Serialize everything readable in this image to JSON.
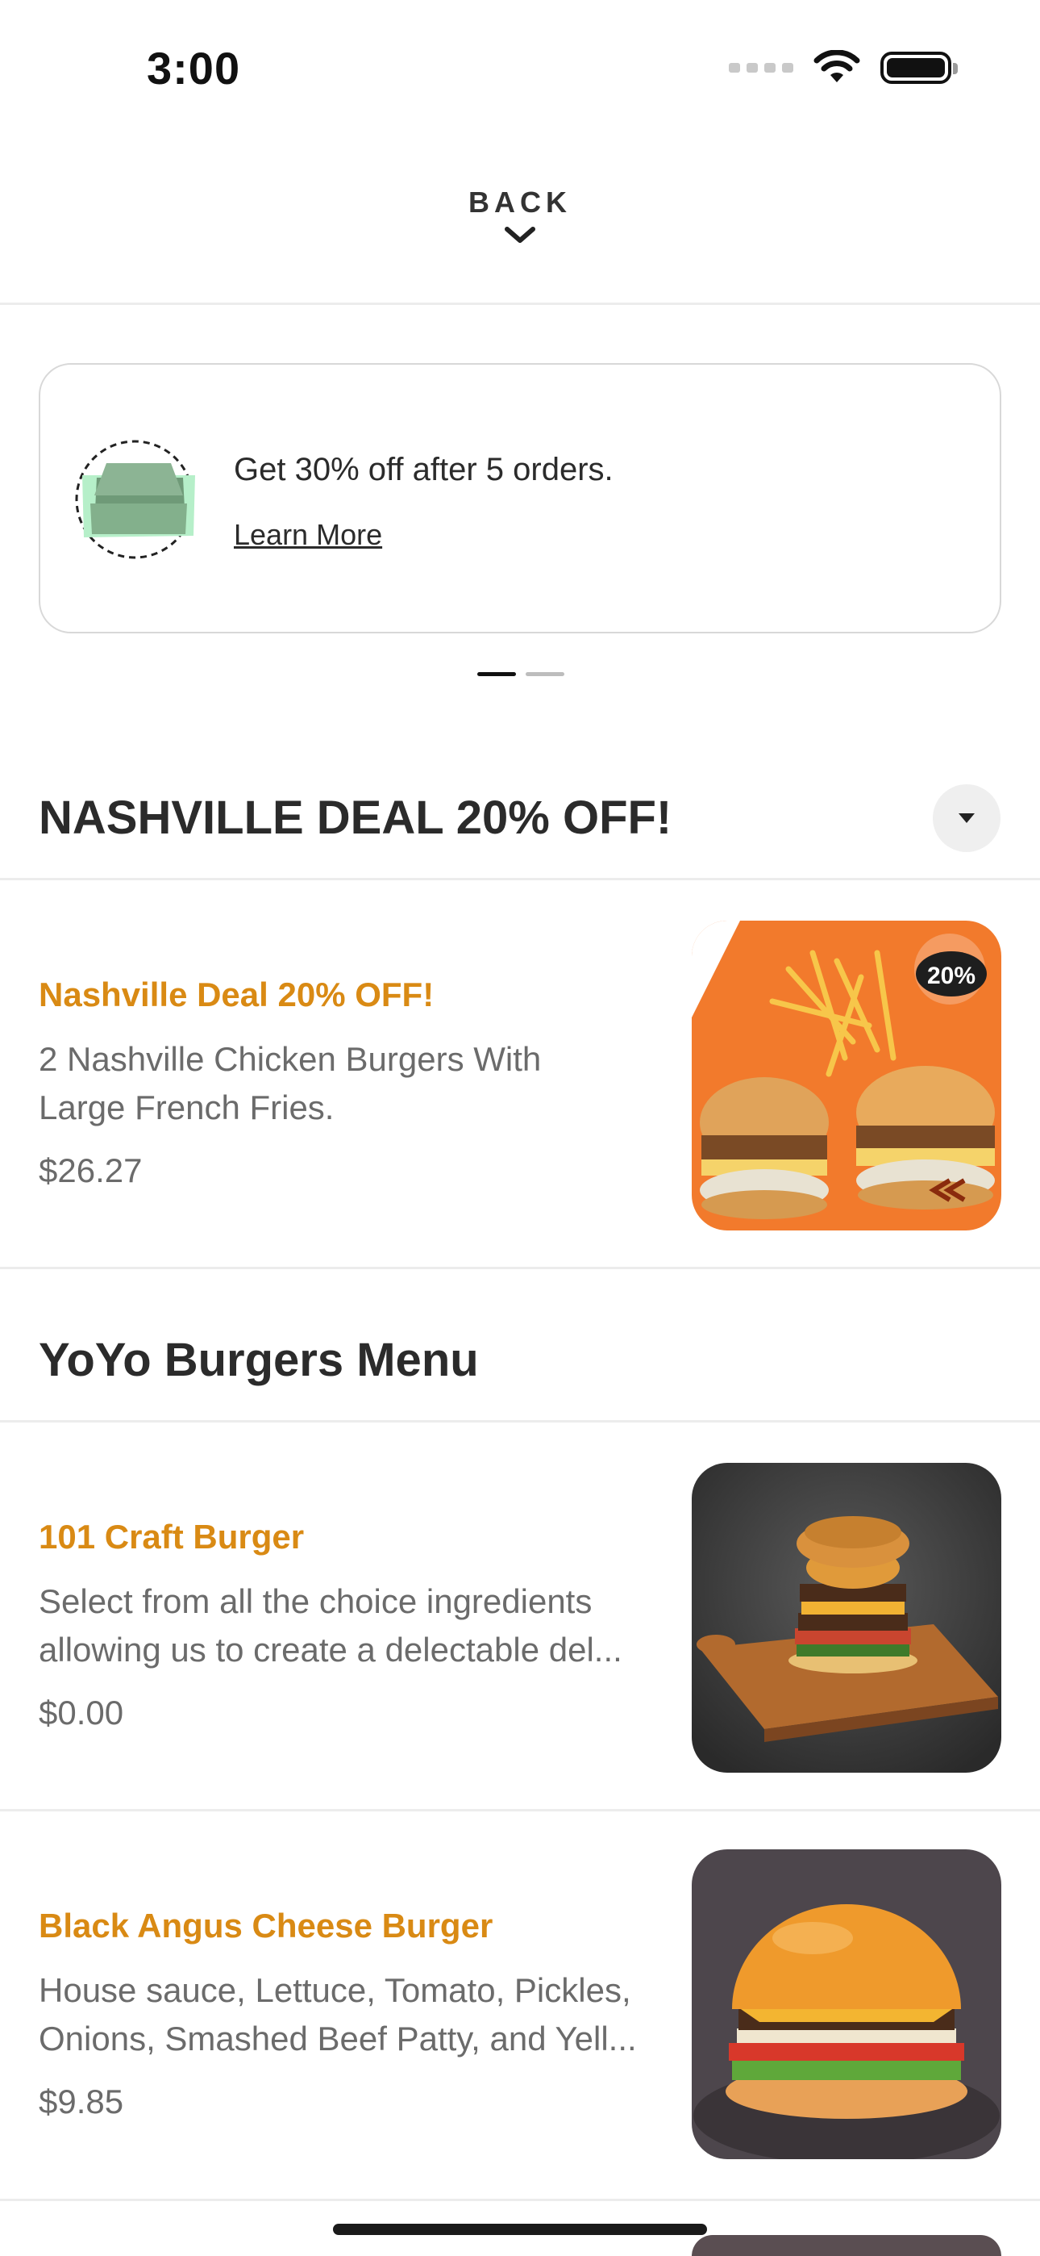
{
  "status_bar": {
    "time": "3:00"
  },
  "header": {
    "back_label": "BACK"
  },
  "promo": {
    "text": "Get 30% off after 5 orders.",
    "link": "Learn More"
  },
  "sections": [
    {
      "title": "NASHVILLE DEAL 20% OFF!"
    },
    {
      "title": "YoYo Burgers Menu"
    }
  ],
  "deal_item": {
    "name": "Nashville Deal 20% OFF!",
    "desc_line1": "2 Nashville Chicken Burgers With",
    "desc_line2": "Large French Fries.",
    "price": "$26.27",
    "badge": "20%"
  },
  "menu_items": [
    {
      "name": "101 Craft Burger",
      "desc_line1": "Select from all the choice ingredients",
      "desc_line2": "allowing us to create a delectable del...",
      "price": "$0.00"
    },
    {
      "name": "Black Angus Cheese Burger",
      "desc_line1": "House sauce, Lettuce, Tomato, Pickles,",
      "desc_line2": "Onions, Smashed Beef Patty, and Yell...",
      "price": "$9.85"
    }
  ],
  "colors": {
    "accent": "#d98a14",
    "text": "#2b2b2b",
    "muted": "#6b6b6b",
    "divider": "#ececec"
  }
}
